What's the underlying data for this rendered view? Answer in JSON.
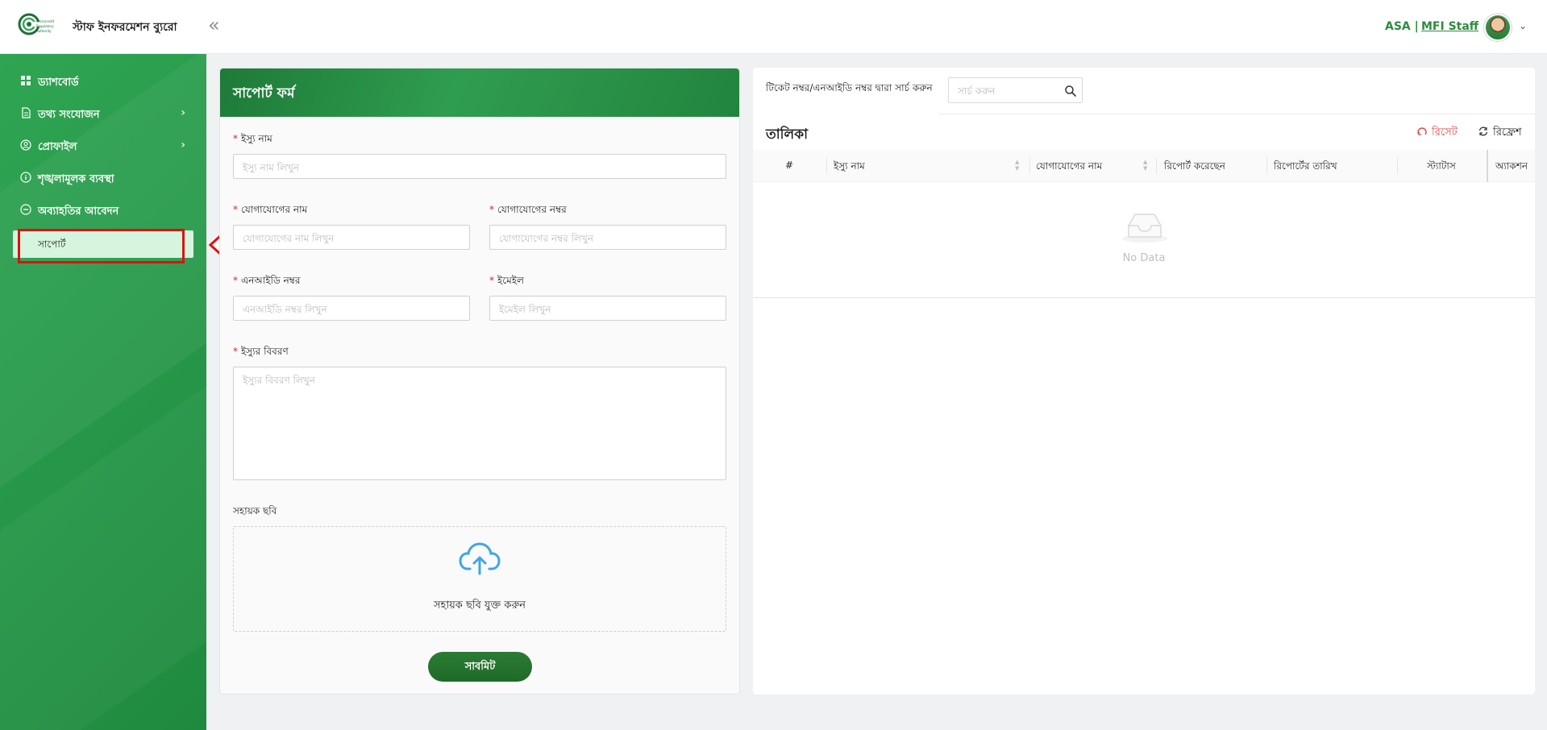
{
  "header": {
    "brand_title": "স্টাফ ইনফরমেশন ব্যুরো",
    "collapse_icon": "double-chevron-left-icon",
    "org": "ASA |",
    "staff": "MFI Staff",
    "logo_icon": "mra-logo-icon",
    "avatar": "user-avatar"
  },
  "sidebar": {
    "items": [
      {
        "label": "ড্যাশবোর্ড",
        "icon": "dashboard-icon",
        "has_submenu": false
      },
      {
        "label": "তথ্য সংযোজন",
        "icon": "document-icon",
        "has_submenu": true
      },
      {
        "label": "প্রোফাইল",
        "icon": "profile-icon",
        "has_submenu": true
      },
      {
        "label": "শৃঙ্খলামূলক ব্যবস্থা",
        "icon": "info-icon",
        "has_submenu": false
      },
      {
        "label": "অব্যাহতির আবেদন",
        "icon": "minus-circle-icon",
        "has_submenu": false
      }
    ],
    "active_sub": {
      "label": "সাপোর্ট"
    }
  },
  "form": {
    "title": "সাপোর্ট ফর্ম",
    "issue_name": {
      "label": "ইস্যু নাম",
      "placeholder": "ইস্যু নাম লিখুন",
      "required": true
    },
    "contact_name": {
      "label": "যোগাযোগের নাম",
      "placeholder": "যোগাযোগের নাম লিখুন",
      "required": true
    },
    "contact_number": {
      "label": "যোগাযোগের নম্বর",
      "placeholder": "যোগাযোগের নম্বর লিখুন",
      "required": true
    },
    "nid": {
      "label": "এনআইডি নম্বর",
      "placeholder": "এনআইডি নম্বর লিখুন",
      "required": true
    },
    "email": {
      "label": "ইমেইল",
      "placeholder": "ইমেইল লিখুন",
      "required": true
    },
    "description": {
      "label": "ইস্যুর বিবরণ",
      "placeholder": "ইস্যুর বিবরণ লিখুন",
      "required": true
    },
    "image": {
      "label": "সহায়ক ছবি",
      "upload_text": "সহায়ক ছবি যুক্ত করুন",
      "icon": "cloud-upload-icon"
    },
    "required_mark": "*",
    "submit_label": "সাবমিট"
  },
  "table": {
    "search_label": "টিকেট নম্বর/এনআইডি নম্বর দ্বারা সার্চ করুন",
    "search_placeholder": "সার্চ করুন",
    "title": "তালিকা",
    "reset_label": "রিসেট",
    "refresh_label": "রিফ্রেশ",
    "columns": [
      "#",
      "ইস্যু নাম",
      "যোগাযোগের নাম",
      "রিপোর্ট করেছেন",
      "রিপোর্টের তারিখ",
      "স্ট্যাটাস",
      "অ্যাকশন"
    ],
    "rows": [],
    "empty_text": "No Data"
  },
  "colors": {
    "brand_green": "#2e8b3e",
    "sidebar_green": "#27994a",
    "active_sub_bg": "#d5f5df",
    "annotation_red": "#e01010",
    "upload_blue": "#3ea6e8"
  }
}
